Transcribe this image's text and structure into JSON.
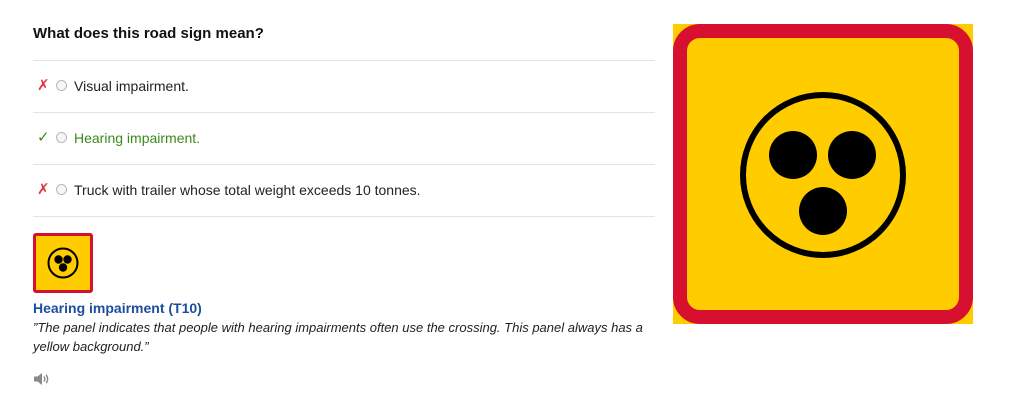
{
  "question": {
    "title": "What does this road sign mean?"
  },
  "options": [
    {
      "mark": "✗",
      "status": "wrong",
      "label": "Visual impairment."
    },
    {
      "mark": "✓",
      "status": "correct",
      "label": "Hearing impairment."
    },
    {
      "mark": "✗",
      "status": "wrong",
      "label": "Truck with trailer whose total weight exceeds 10 tonnes."
    }
  ],
  "explanation": {
    "sign_name": "Hearing impairment (T10)",
    "description": "”The panel indicates that people with hearing impairments often use the crossing. This panel always has a yellow background.”"
  },
  "icons": {
    "wrong_mark": "cross-mark-icon",
    "correct_mark": "check-mark-icon",
    "audio": "speaker-icon",
    "sign": "hearing-impairment-sign"
  },
  "colors": {
    "wrong": "#e2343c",
    "correct": "#3c8a1e",
    "link": "#1d4e9e",
    "sign_border": "#d8102f",
    "sign_fill": "#ffcc00"
  }
}
